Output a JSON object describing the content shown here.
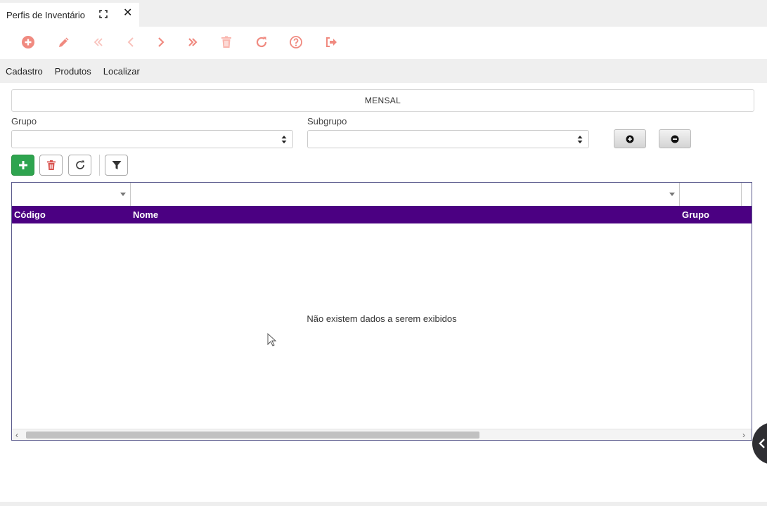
{
  "tab": {
    "title": "Perfis de Inventário"
  },
  "toolbar": {
    "icons": [
      "add-circle-icon",
      "pencil-icon",
      "double-chevron-left-icon",
      "chevron-left-icon",
      "chevron-right-icon",
      "double-chevron-right-icon",
      "trash-icon",
      "refresh-icon",
      "help-icon",
      "exit-icon"
    ],
    "icon_color": "#f08a80"
  },
  "menu": {
    "items": [
      "Cadastro",
      "Produtos",
      "Localizar"
    ]
  },
  "form": {
    "profile_name": "MENSAL",
    "grupo_label": "Grupo",
    "grupo_value": "",
    "subgrupo_label": "Subgrupo",
    "subgrupo_value": ""
  },
  "grid": {
    "columns": [
      "Código",
      "Nome",
      "Grupo"
    ],
    "empty_message": "Não existem dados a serem exibidos",
    "header_color": "#4b0082"
  }
}
